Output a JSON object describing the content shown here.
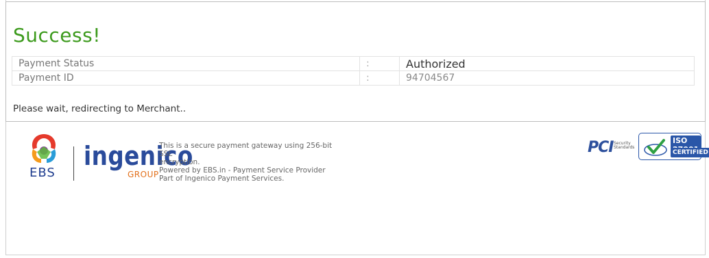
{
  "header": {
    "title": "Success!"
  },
  "status_table": {
    "rows": [
      {
        "label": "Payment Status",
        "separator": ":",
        "value": "Authorized"
      },
      {
        "label": "Payment ID",
        "separator": ":",
        "value": "94704567"
      }
    ]
  },
  "redirect_message": "Please wait, redirecting to Merchant..",
  "footer": {
    "ebs_logo_text": "EBS",
    "ingenico_text": "ingenico",
    "group_text": "GROUP",
    "line1": "This is a secure payment gateway using 256-bit SSL",
    "line2": "encryption.",
    "line3": "Powered by EBS.in - Payment Service Provider",
    "line4": "Part of Ingenico Payment Services.",
    "pci_text": "PCI",
    "pci_sub1": "Security",
    "pci_sub2": "Standards",
    "iso_top": "ISO 27001",
    "iso_bottom": "CERTIFIED"
  },
  "colors": {
    "success_green": "#3c9a1c",
    "ingenico_blue": "#2a4b9b",
    "group_orange": "#e2701b",
    "iso_blue": "#2a56a8"
  },
  "icons": [
    "ebs-logo-icon",
    "pci-logo-icon",
    "iso-check-icon"
  ]
}
